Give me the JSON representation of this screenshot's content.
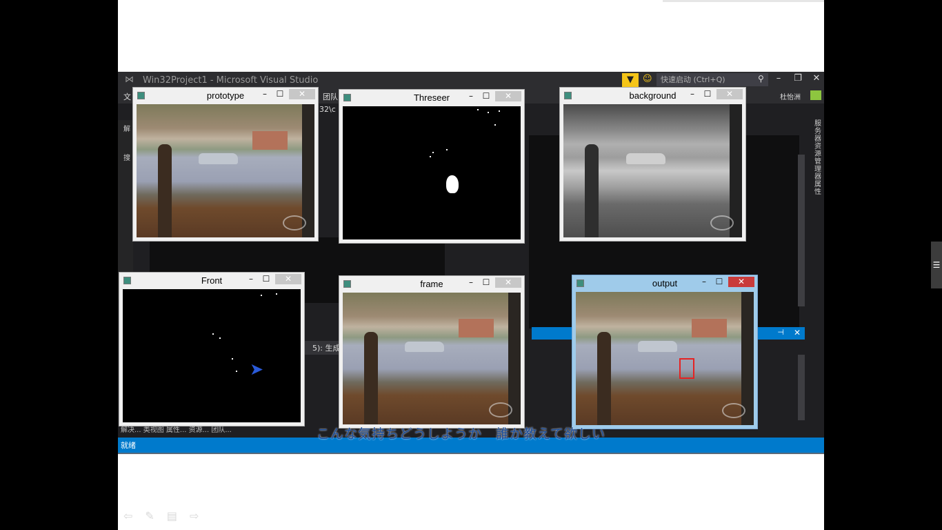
{
  "vs": {
    "title": "Win32Project1 - Microsoft Visual Studio",
    "quick_launch": "快速启动 (Ctrl+Q)",
    "menu": {
      "file": "文",
      "team": "团队",
      "solution": "解",
      "search": "搜"
    },
    "user": "杜怡洲",
    "breadcrumb": "32\\c",
    "side_panels": "服务器资源管理器 属性",
    "output_label": "生成",
    "output_prefix": "5):",
    "status": "就绪",
    "bottom_tabs": "解决... 类视图 属性... 资源... 团队..."
  },
  "windows": {
    "prototype": "prototype",
    "threseer": "Threseer",
    "background": "background",
    "front": "Front",
    "frame": "frame",
    "output": "output"
  },
  "subtitle": "こんな気持ちどうしようか　誰か教えて欲しい",
  "icons": [
    "vs-logo-icon",
    "filter-icon",
    "smiley-icon",
    "search-icon",
    "minimize-icon",
    "maximize-icon",
    "close-icon",
    "opencv-window-icon",
    "eye-watermark-icon",
    "mouse-cursor-icon",
    "prev-slide-icon",
    "pen-icon",
    "menu-icon",
    "next-slide-icon"
  ]
}
